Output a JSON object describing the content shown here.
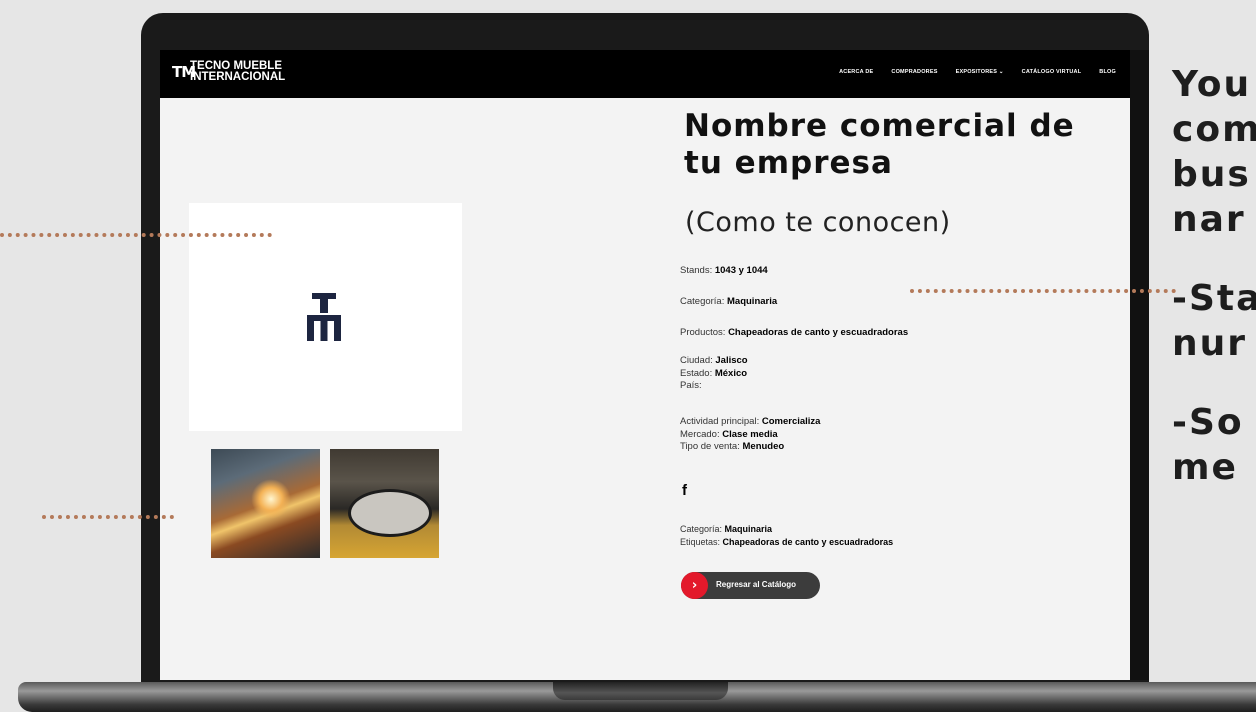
{
  "nav": {
    "logo_line1": "TECNO MUEBLE",
    "logo_line2": "INTERNACIONAL",
    "logo_mark": "TM",
    "items": [
      "ACERCA DE",
      "COMPRADORES",
      "EXPOSITORES ⌄",
      "CATÁLOGO VIRTUAL",
      "BLOG"
    ]
  },
  "product": {
    "title": "Nombre comercial de tu empresa",
    "subtitle": "(Como te conocen)",
    "stands_label": "Stands: ",
    "stands_value": "1043 y 1044",
    "categoria_label": "Categoría: ",
    "categoria_value": "Maquinaria",
    "productos_label": "Productos: ",
    "productos_value": "Chapeadoras de canto y escuadradoras",
    "ciudad_label": "Ciudad: ",
    "ciudad_value": "Jalisco",
    "estado_label": "Estado: ",
    "estado_value": "México",
    "pais_label": "País:",
    "actividad_label": "Actividad principal: ",
    "actividad_value": "Comercializa",
    "mercado_label": "Mercado: ",
    "mercado_value": "Clase media",
    "venta_label": "Tipo de venta: ",
    "venta_value": "Menudeo",
    "facebook_icon": "f",
    "footer_categoria_label": "Categoría: ",
    "footer_categoria_value": "Maquinaria",
    "etiquetas_label": "Etiquetas: ",
    "etiquetas_value": "Chapeadoras de canto y escuadradoras",
    "back_button_label": "Regresar al Catálogo"
  },
  "side_text": {
    "line1": "You",
    "line2": "com",
    "line3": "bus",
    "line4": "nar",
    "line5": "-Sta",
    "line6": "nur",
    "line7": "-So",
    "line8": "me"
  },
  "colors": {
    "accent": "#e3192b",
    "dotted_guides": "#b47a5a"
  }
}
